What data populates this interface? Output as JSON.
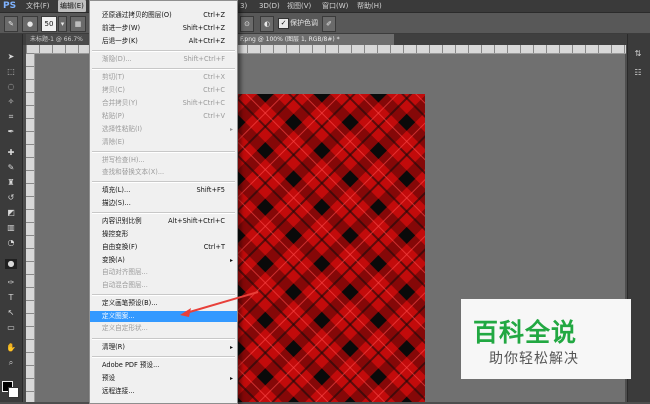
{
  "app": {
    "logo": "PS"
  },
  "menubar": {
    "items": [
      "文件(F)",
      "编辑(E)",
      "3)",
      "3D(D)",
      "视图(V)",
      "窗口(W)",
      "帮助(H)"
    ]
  },
  "options": {
    "brush_size": "50",
    "protect_checkbox": "✓",
    "protect_label": "保护色调"
  },
  "tabs": {
    "left_doc": "未标题-1 @ 66.7%",
    "right_doc": "F.png @ 100% (图层 1, RGB/8#) *"
  },
  "edit_menu": {
    "items": [
      {
        "label": "还原通过拷贝的图层(O)",
        "shortcut": "Ctrl+Z",
        "disabled": false
      },
      {
        "label": "前进一步(W)",
        "shortcut": "Shift+Ctrl+Z",
        "disabled": false
      },
      {
        "label": "后退一步(K)",
        "shortcut": "Alt+Ctrl+Z",
        "disabled": false
      },
      {
        "label": "渐隐(D)...",
        "shortcut": "Shift+Ctrl+F",
        "disabled": true
      },
      {
        "label": "剪切(T)",
        "shortcut": "Ctrl+X",
        "disabled": true
      },
      {
        "label": "拷贝(C)",
        "shortcut": "Ctrl+C",
        "disabled": true
      },
      {
        "label": "合并拷贝(Y)",
        "shortcut": "Shift+Ctrl+C",
        "disabled": true
      },
      {
        "label": "粘贴(P)",
        "shortcut": "Ctrl+V",
        "disabled": true
      },
      {
        "label": "选择性粘贴(I)",
        "shortcut": "",
        "disabled": true,
        "submenu": true
      },
      {
        "label": "清除(E)",
        "shortcut": "",
        "disabled": true
      },
      {
        "label": "拼写检查(H)...",
        "shortcut": "",
        "disabled": true
      },
      {
        "label": "查找和替换文本(X)...",
        "shortcut": "",
        "disabled": true
      },
      {
        "label": "填充(L)...",
        "shortcut": "Shift+F5",
        "disabled": false
      },
      {
        "label": "描边(S)...",
        "shortcut": "",
        "disabled": false
      },
      {
        "label": "内容识别比例",
        "shortcut": "Alt+Shift+Ctrl+C",
        "disabled": false
      },
      {
        "label": "操控变形",
        "shortcut": "",
        "disabled": false
      },
      {
        "label": "自由变换(F)",
        "shortcut": "Ctrl+T",
        "disabled": false
      },
      {
        "label": "变换(A)",
        "shortcut": "",
        "disabled": false,
        "submenu": true
      },
      {
        "label": "自动对齐图层...",
        "shortcut": "",
        "disabled": true
      },
      {
        "label": "自动混合图层...",
        "shortcut": "",
        "disabled": true
      },
      {
        "label": "定义画笔预设(B)...",
        "shortcut": "",
        "disabled": false
      },
      {
        "label": "定义图案...",
        "shortcut": "",
        "disabled": false,
        "highlighted": true
      },
      {
        "label": "定义自定形状...",
        "shortcut": "",
        "disabled": true
      },
      {
        "label": "清理(R)",
        "shortcut": "",
        "disabled": false,
        "submenu": true
      },
      {
        "label": "Adobe PDF 预设...",
        "shortcut": "",
        "disabled": false
      },
      {
        "label": "预设",
        "shortcut": "",
        "disabled": false,
        "submenu": true
      },
      {
        "label": "远程连接...",
        "shortcut": "",
        "disabled": false
      }
    ]
  },
  "watermark": {
    "title": "百科全说",
    "subtitle": "助你轻松解决"
  },
  "colors": {
    "plaid_red": "#c20b0b",
    "plaid_black": "#0a0a0a",
    "highlight": "#3399ff",
    "watermark_green": "#22a842",
    "arrow": "#e8403a"
  }
}
